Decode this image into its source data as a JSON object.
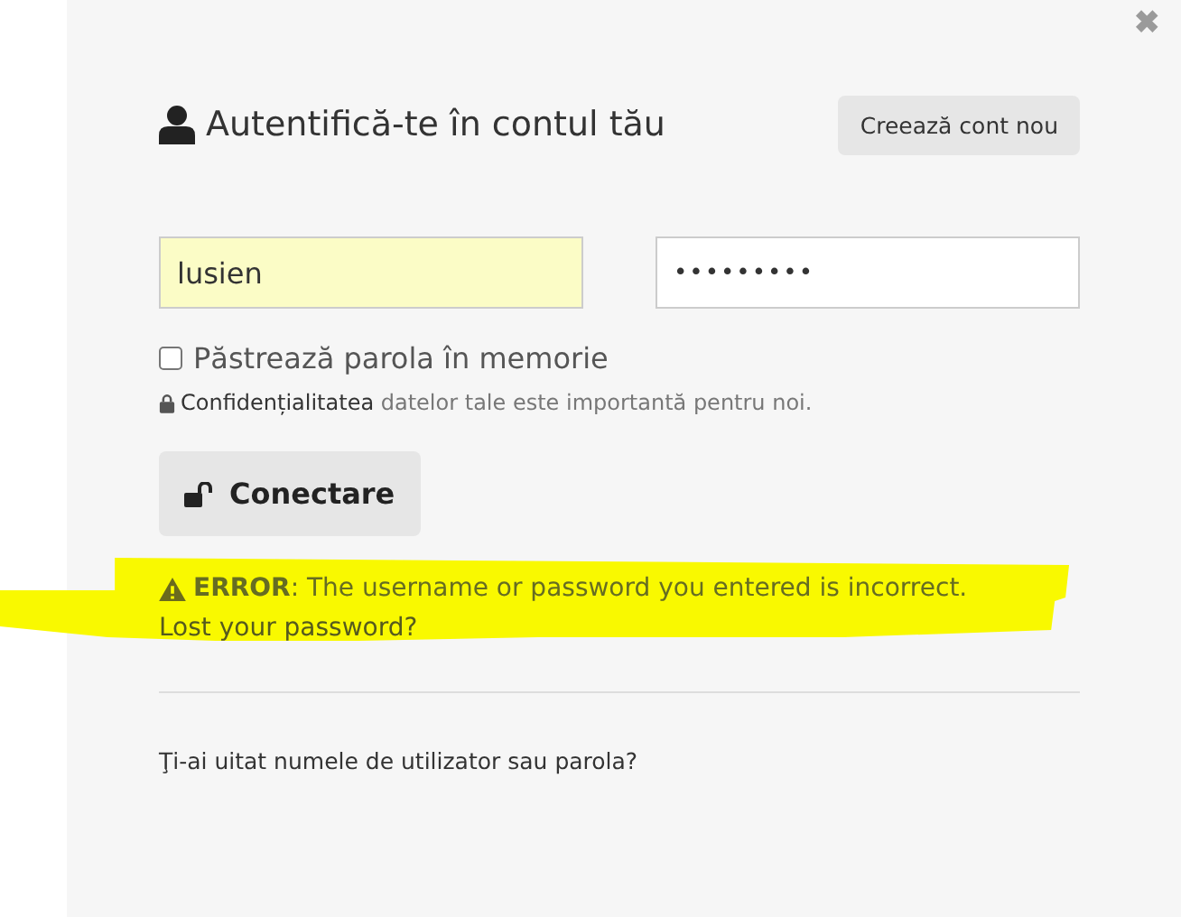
{
  "dialog": {
    "title": "Autentifică-te în contul tău",
    "create_button": "Creează cont nou",
    "close_label": "✖"
  },
  "login": {
    "username": "lusien",
    "password_mask": "•••••••••",
    "remember": {
      "label": "Păstrează parola în memorie",
      "checked": false
    },
    "privacy": "**Confidențialitatea** datelor tale este importantă pentru noi.",
    "submit": "Conectare"
  },
  "error": {
    "message": "**ERROR**: The username or password you entered is incorrect.",
    "link": "Lost your password?",
    "highlighted": true
  },
  "forgot_link": "Ţi-ai uitat numele de utilizator sau parola?"
}
